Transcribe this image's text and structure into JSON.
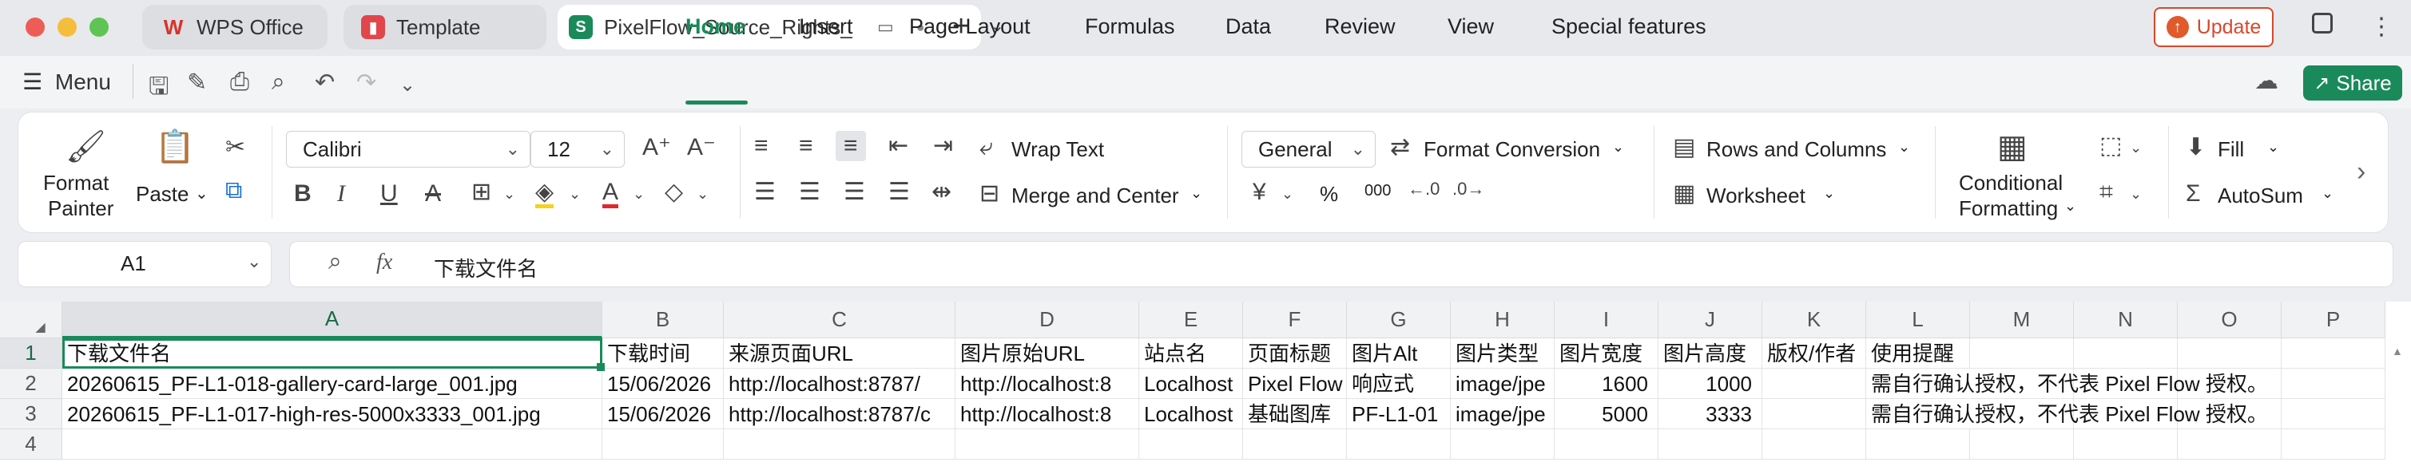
{
  "title_bar": {
    "tabs": [
      {
        "label": "WPS Office",
        "icon": "wps-logo-icon",
        "active": false
      },
      {
        "label": "Template",
        "icon": "template-icon",
        "active": false
      },
      {
        "label": "PixelFlow_Source_Rights_",
        "icon": "spreadsheet-icon",
        "active": true
      }
    ],
    "update_label": "Update"
  },
  "menu_bar": {
    "menu_label": "Menu",
    "tabs": [
      "Home",
      "Insert",
      "Page Layout",
      "Formulas",
      "Data",
      "Review",
      "View",
      "Special features"
    ],
    "active_tab": "Home",
    "share_label": "Share"
  },
  "ribbon": {
    "format_painter": "Format Painter",
    "format_painter_l1": "Format",
    "format_painter_l2": "Painter",
    "paste": "Paste",
    "font_name": "Calibri",
    "font_size": "12",
    "wrap_text": "Wrap Text",
    "merge_center": "Merge and Center",
    "number_format": "General",
    "format_conversion": "Format Conversion",
    "rows_columns": "Rows and Columns",
    "worksheet": "Worksheet",
    "conditional_formatting": "Conditional Formatting",
    "cf_l1": "Conditional",
    "cf_l2": "Formatting",
    "fill": "Fill",
    "autosum": "AutoSum",
    "percent": "%",
    "thousands": "000"
  },
  "formula_bar": {
    "name_box": "A1",
    "fx": "fx",
    "content": "下载文件名"
  },
  "sheet": {
    "columns": [
      "A",
      "B",
      "C",
      "D",
      "E",
      "F",
      "G",
      "H",
      "I",
      "J",
      "K",
      "L",
      "M",
      "N",
      "O",
      "P"
    ],
    "rows": [
      "1",
      "2",
      "3",
      "4"
    ],
    "selected_cell": "A1",
    "data": [
      [
        "下载文件名",
        "下载时间",
        "来源页面URL",
        "图片原始URL",
        "站点名",
        "页面标题",
        "图片Alt",
        "图片类型",
        "图片宽度",
        "图片高度",
        "版权/作者",
        "使用提醒"
      ],
      [
        "20260615_PF-L1-018-gallery-card-large_001.jpg",
        "15/06/2026",
        "http://localhost:8787/",
        "http://localhost:8",
        "Localhost",
        "Pixel Flow",
        "响应式",
        "image/jpe",
        "1600",
        "1000",
        "",
        "需自行确认授权，不代表 Pixel Flow 授权。"
      ],
      [
        "20260615_PF-L1-017-high-res-5000x3333_001.jpg",
        "15/06/2026",
        "http://localhost:8787/c",
        "http://localhost:8",
        "Localhost",
        "基础图库",
        "PF-L1-01",
        "image/jpe",
        "5000",
        "3333",
        "",
        "需自行确认授权，不代表 Pixel Flow 授权。"
      ]
    ]
  },
  "colors": {
    "accent": "#1a8a5a",
    "update": "#d9472b",
    "traffic_red": "#ee5d55",
    "traffic_yellow": "#f5bd3c",
    "traffic_green": "#5fc454"
  }
}
